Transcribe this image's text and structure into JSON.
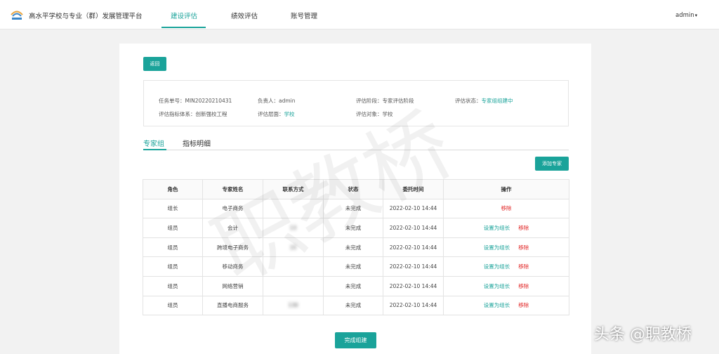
{
  "header": {
    "brand": "高水平学校与专业（群）发展管理平台",
    "nav": [
      "建设评估",
      "绩效评估",
      "账号管理"
    ],
    "user": "admin",
    "user_caret": "▾"
  },
  "toolbar": {
    "back_label": "返回",
    "add_expert_label": "添加专家",
    "finish_label": "完成组建"
  },
  "task": {
    "number_label": "任务单号：",
    "number": "MIN20220210431",
    "owner_label": "负责人：",
    "owner": "admin",
    "stage_label": "评估阶段：",
    "stage": "专家评估阶段",
    "status_label": "评估状态：",
    "status": "专家组组建中",
    "system_label": "评估指标体系：",
    "system": "创新强校工程",
    "level_label": "评估层面：",
    "level": "学校",
    "object_label": "评估对象：",
    "object": "学校"
  },
  "tabs": [
    "专家组",
    "指标明细"
  ],
  "table": {
    "headers": [
      "角色",
      "专家姓名",
      "联系方式",
      "状态",
      "委托时间",
      "操作"
    ],
    "set_leader_label": "设置为组长",
    "remove_label": "移除",
    "rows": [
      {
        "role": "组长",
        "name": "电子商务",
        "contact": "",
        "status": "未完成",
        "time": "2022-02-10 14:44"
      },
      {
        "role": "组员",
        "name": "会计",
        "contact": "13",
        "status": "未完成",
        "time": "2022-02-10 14:44"
      },
      {
        "role": "组员",
        "name": "跨境电子商务",
        "contact": "15",
        "status": "未完成",
        "time": "2022-02-10 14:44"
      },
      {
        "role": "组员",
        "name": "移动商务",
        "contact": "",
        "status": "未完成",
        "time": "2022-02-10 14:44"
      },
      {
        "role": "组员",
        "name": "网络营销",
        "contact": "",
        "status": "未完成",
        "time": "2022-02-10 14:44"
      },
      {
        "role": "组员",
        "name": "直播电商服务",
        "contact": "130",
        "status": "未完成",
        "time": "2022-02-10 14:44"
      }
    ]
  },
  "watermark": "职教桥",
  "corner_watermark": "头条 @职教桥",
  "colors": {
    "accent": "#1aa39a",
    "danger": "#e02020",
    "background": "#f2f2f2"
  }
}
